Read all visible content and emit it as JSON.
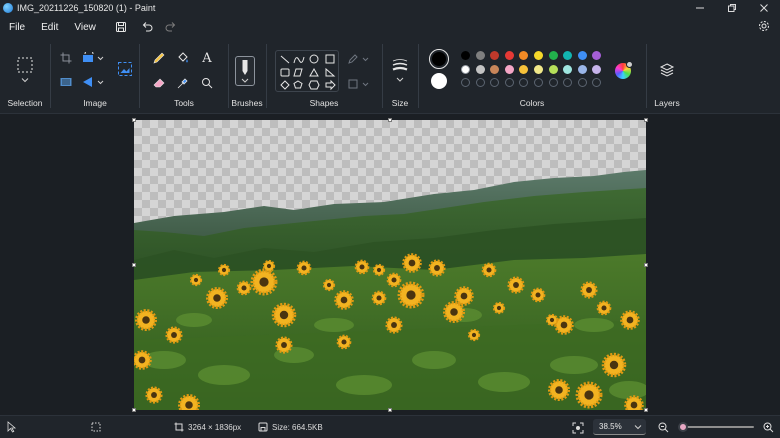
{
  "window": {
    "title": "IMG_20211226_150820 (1) - Paint",
    "controls": [
      "minimize-icon",
      "restore-icon",
      "close-icon"
    ]
  },
  "menu": {
    "items": [
      "File",
      "Edit",
      "View"
    ],
    "quick_icons": [
      "save-icon",
      "undo-icon",
      "redo-icon"
    ]
  },
  "ribbon": {
    "groups": {
      "selection": "Selection",
      "image": "Image",
      "tools": "Tools",
      "brushes": "Brushes",
      "shapes": "Shapes",
      "size": "Size",
      "colors": "Colors",
      "layers": "Layers"
    },
    "tool_text_icon": "A",
    "colors": {
      "primary": "#000000",
      "secondary": "#ffffff",
      "palette_row1": [
        "#000000",
        "#7f7f7f",
        "#c0392b",
        "#e53935",
        "#f28a25",
        "#f5d82a",
        "#22b14c",
        "#12b5b0",
        "#3f8ff5",
        "#a55fd6"
      ],
      "palette_row2": [
        "#ffffff",
        "#c3c3c3",
        "#c9865a",
        "#f4a6c6",
        "#f7c23a",
        "#f0e88a",
        "#b6e05a",
        "#9fe6e0",
        "#9ab6e8",
        "#c6b3ea"
      ],
      "palette_row3_slots": 10
    }
  },
  "canvas": {
    "image": "sunflower-field-hills-photo",
    "background": "transparent-checkerboard"
  },
  "status": {
    "dimensions": "3264 × 1836px",
    "size": "Size: 664.5KB",
    "zoom": "38.5%",
    "zoom_fraction": 0.0
  }
}
